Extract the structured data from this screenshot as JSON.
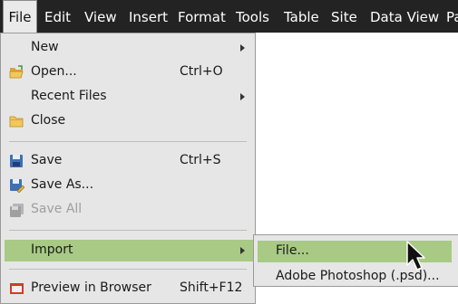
{
  "menubar": {
    "items": [
      "File",
      "Edit",
      "View",
      "Insert",
      "Format",
      "Tools",
      "Table",
      "Site",
      "Data View",
      "Pa"
    ]
  },
  "file_menu": {
    "new": {
      "label": "New"
    },
    "open": {
      "label": "Open...",
      "shortcut": "Ctrl+O",
      "icon": "open-folder-icon"
    },
    "recent_files": {
      "label": "Recent Files"
    },
    "close": {
      "label": "Close",
      "icon": "close-folder-icon"
    },
    "save": {
      "label": "Save",
      "shortcut": "Ctrl+S",
      "icon": "floppy-disk-icon"
    },
    "save_as": {
      "label": "Save As...",
      "icon": "save-as-icon"
    },
    "save_all": {
      "label": "Save All",
      "icon": "save-all-icon",
      "disabled": true
    },
    "import": {
      "label": "Import",
      "highlighted": true
    },
    "preview": {
      "label": "Preview in Browser",
      "shortcut": "Shift+F12",
      "icon": "browser-preview-icon"
    }
  },
  "import_submenu": {
    "items": [
      {
        "label": "File...",
        "highlighted": true
      },
      {
        "label": "Adobe Photoshop (.psd)..."
      }
    ]
  },
  "colors": {
    "menubar_bg": "#232323",
    "menu_bg": "#e6e6e6",
    "highlight": "#a8ca84"
  }
}
